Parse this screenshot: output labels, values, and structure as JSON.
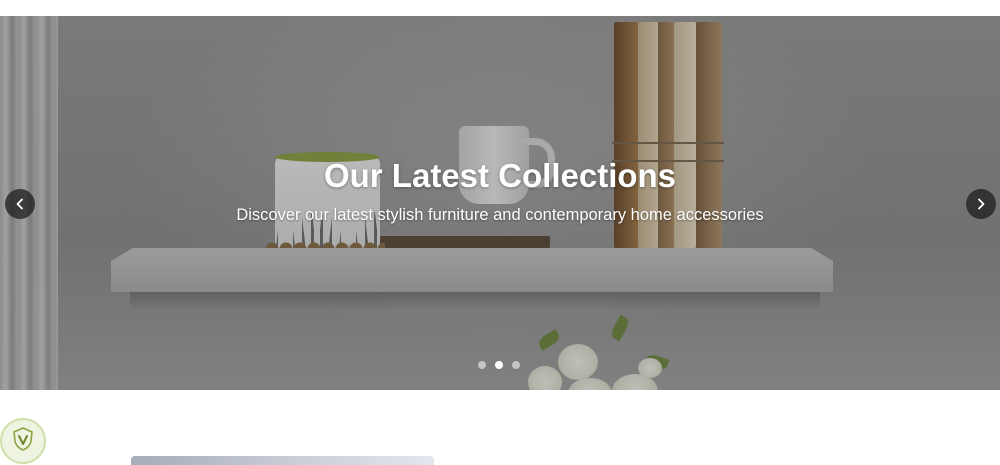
{
  "hero": {
    "title": "Our Latest Collections",
    "subtitle": "Discover our latest stylish furniture and contemporary home accessories",
    "prev_icon": "chevron-left-icon",
    "next_icon": "chevron-right-icon",
    "slides_count": 3,
    "active_slide": 2
  },
  "colors": {
    "overlay": "#282828",
    "arrow_bg": "#1e1e1e",
    "logo_accent": "#8fa441"
  },
  "logo": {
    "icon": "shield-leaf-logo-icon"
  }
}
